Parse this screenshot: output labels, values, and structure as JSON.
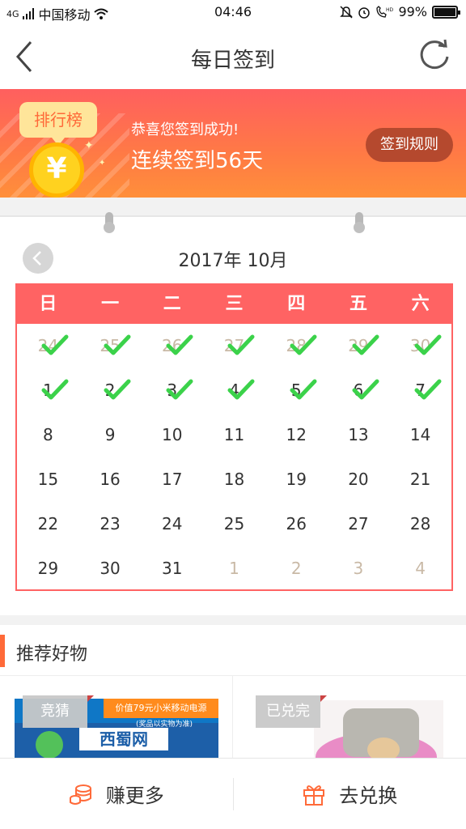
{
  "status_bar": {
    "carrier": "中国移动",
    "network": "4G",
    "time": "04:46",
    "battery": "99%"
  },
  "nav": {
    "title": "每日签到"
  },
  "banner": {
    "rank_label": "排行榜",
    "coin_symbol": "¥",
    "success_text": "恭喜您签到成功!",
    "streak_text": "连续签到56天",
    "rules_button": "签到规则"
  },
  "calendar": {
    "month_title": "2017年 10月",
    "weekdays": [
      "日",
      "一",
      "二",
      "三",
      "四",
      "五",
      "六"
    ],
    "accent_color": "#ff6363",
    "days": [
      {
        "label": "24",
        "other": true,
        "checked": true
      },
      {
        "label": "25",
        "other": true,
        "checked": true
      },
      {
        "label": "26",
        "other": true,
        "checked": true
      },
      {
        "label": "27",
        "other": true,
        "checked": true
      },
      {
        "label": "28",
        "other": true,
        "checked": true
      },
      {
        "label": "29",
        "other": true,
        "checked": true
      },
      {
        "label": "30",
        "other": true,
        "checked": true
      },
      {
        "label": "1",
        "other": false,
        "checked": true
      },
      {
        "label": "2",
        "other": false,
        "checked": true
      },
      {
        "label": "3",
        "other": false,
        "checked": true
      },
      {
        "label": "4",
        "other": false,
        "checked": true
      },
      {
        "label": "5",
        "other": false,
        "checked": true
      },
      {
        "label": "6",
        "other": false,
        "checked": true
      },
      {
        "label": "7",
        "other": false,
        "checked": true
      },
      {
        "label": "8",
        "other": false,
        "checked": false
      },
      {
        "label": "9",
        "other": false,
        "checked": false
      },
      {
        "label": "10",
        "other": false,
        "checked": false
      },
      {
        "label": "11",
        "other": false,
        "checked": false
      },
      {
        "label": "12",
        "other": false,
        "checked": false
      },
      {
        "label": "13",
        "other": false,
        "checked": false
      },
      {
        "label": "14",
        "other": false,
        "checked": false
      },
      {
        "label": "15",
        "other": false,
        "checked": false
      },
      {
        "label": "16",
        "other": false,
        "checked": false
      },
      {
        "label": "17",
        "other": false,
        "checked": false
      },
      {
        "label": "18",
        "other": false,
        "checked": false
      },
      {
        "label": "19",
        "other": false,
        "checked": false
      },
      {
        "label": "20",
        "other": false,
        "checked": false
      },
      {
        "label": "21",
        "other": false,
        "checked": false
      },
      {
        "label": "22",
        "other": false,
        "checked": false
      },
      {
        "label": "23",
        "other": false,
        "checked": false
      },
      {
        "label": "24",
        "other": false,
        "checked": false
      },
      {
        "label": "25",
        "other": false,
        "checked": false
      },
      {
        "label": "26",
        "other": false,
        "checked": false
      },
      {
        "label": "27",
        "other": false,
        "checked": false
      },
      {
        "label": "28",
        "other": false,
        "checked": false
      },
      {
        "label": "29",
        "other": false,
        "checked": false
      },
      {
        "label": "30",
        "other": false,
        "checked": false
      },
      {
        "label": "31",
        "other": false,
        "checked": false
      },
      {
        "label": "1",
        "other": true,
        "checked": false
      },
      {
        "label": "2",
        "other": true,
        "checked": false
      },
      {
        "label": "3",
        "other": true,
        "checked": false
      },
      {
        "label": "4",
        "other": true,
        "checked": false
      }
    ]
  },
  "recommend": {
    "title": "推荐好物",
    "products": [
      {
        "tag": "竞猜",
        "promo": "价值79元小米移动电源",
        "promo_sub": "(奖品以实物为准)",
        "brand": "西蜀网"
      },
      {
        "tag": "已兑完"
      }
    ]
  },
  "bottom_bar": {
    "earn_more": "赚更多",
    "redeem": "去兑换"
  },
  "colors": {
    "brand_red": "#ff6363",
    "banner_orange": "#ff8f3a",
    "check_green": "#3bd24a",
    "icon_orange": "#ff6a39"
  }
}
